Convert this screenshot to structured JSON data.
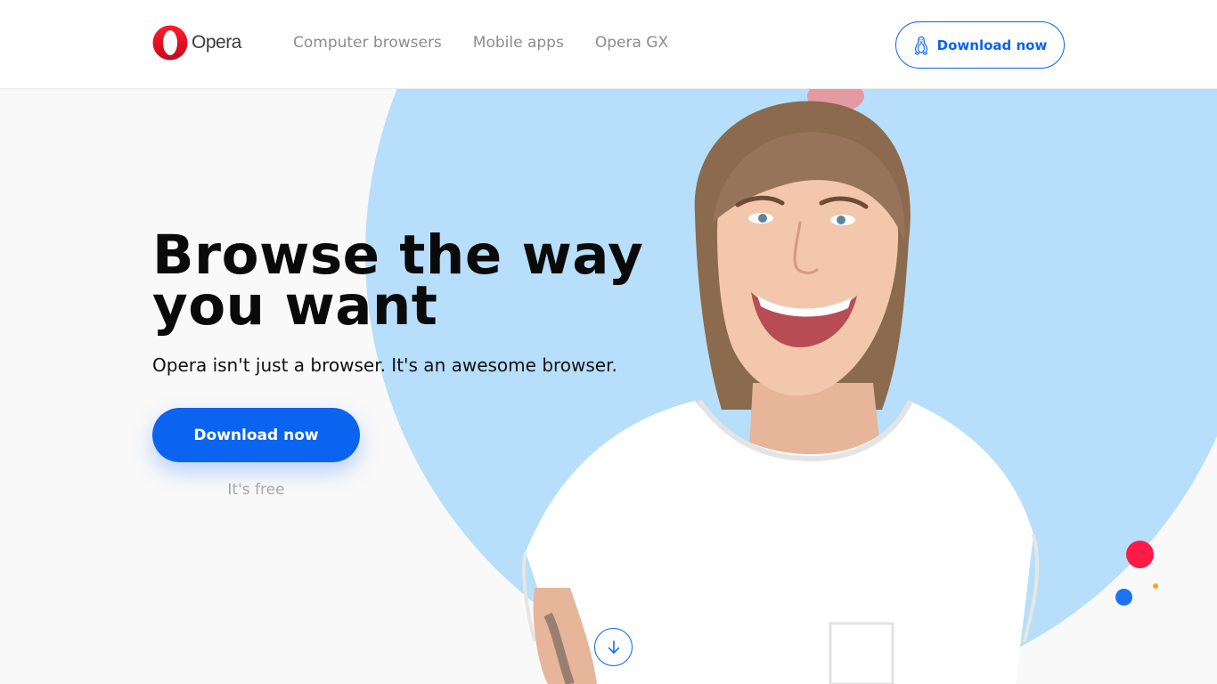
{
  "brand": {
    "name": "Opera",
    "color": "#ff1b2d"
  },
  "nav": {
    "items": [
      {
        "label": "Computer browsers"
      },
      {
        "label": "Mobile apps"
      },
      {
        "label": "Opera GX"
      }
    ]
  },
  "header_cta": {
    "label": "Download now",
    "icon": "linux-tux-icon"
  },
  "hero": {
    "title_line1": "Browse the way",
    "title_line2": "you want",
    "subtitle": "Opera isn't just a browser. It's an awesome browser.",
    "cta_label": "Download now",
    "cta_note": "It's free",
    "scroll_icon": "arrow-down-icon"
  },
  "colors": {
    "accent": "#0a64f0",
    "circle": "#b7dffb",
    "dot_red": "#ff1b48",
    "dot_blue": "#1a73f0",
    "dot_orange": "#ffa319"
  }
}
